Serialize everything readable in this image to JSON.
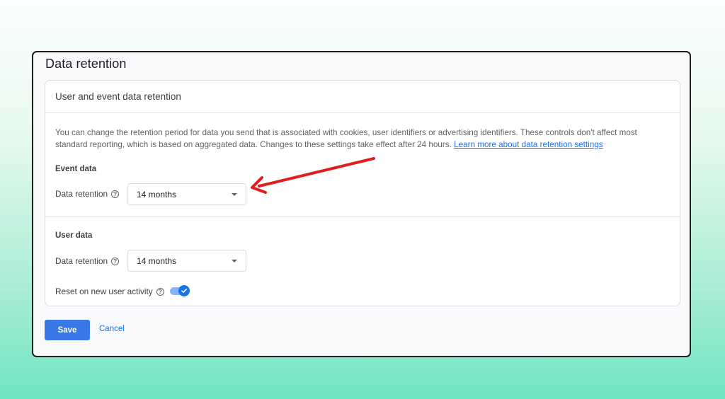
{
  "page": {
    "title": "Data retention"
  },
  "card": {
    "header": "User and event data retention",
    "description": "You can change the retention period for data you send that is associated with cookies, user identifiers or advertising identifiers. These controls don't affect most standard reporting, which is based on aggregated data. Changes to these settings take effect after 24 hours.",
    "learn_more_link": "Learn more about data retention settings"
  },
  "event_data": {
    "label": "Event data",
    "field_label": "Data retention",
    "selected_value": "14 months"
  },
  "user_data": {
    "label": "User data",
    "field_label": "Data retention",
    "selected_value": "14 months",
    "reset_label": "Reset on new user activity",
    "reset_enabled": true
  },
  "actions": {
    "save": "Save",
    "cancel": "Cancel"
  },
  "colors": {
    "primary": "#1a73e8",
    "save_button": "#3b78e7",
    "annotation_arrow": "#e01e1e",
    "toggle_track": "#8ab4f8"
  },
  "icons": {
    "help": "question-circle-icon",
    "dropdown": "chevron-down-icon",
    "toggle_check": "check-icon"
  }
}
